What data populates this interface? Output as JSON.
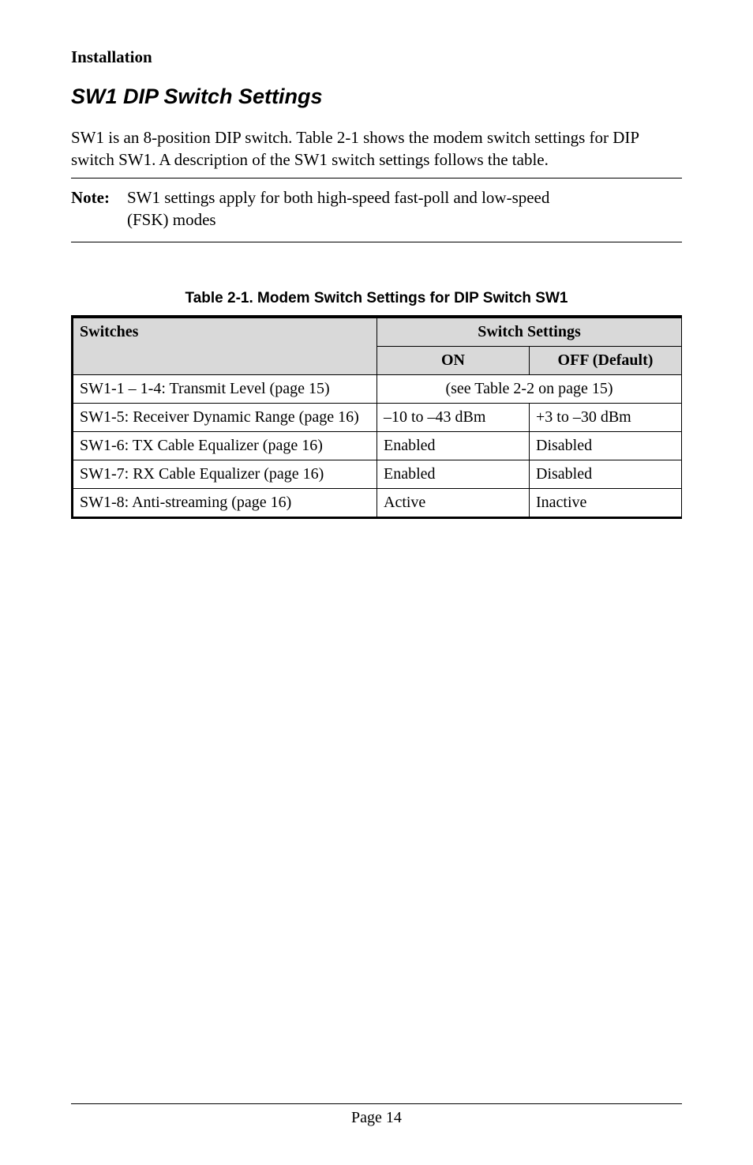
{
  "section_label": "Installation",
  "heading": "SW1 DIP Switch Settings",
  "intro": "SW1 is an 8-position DIP switch. Table 2-1 shows the modem switch settings for DIP switch SW1. A description of the SW1 switch settings follows the table.",
  "note": {
    "label": "Note:",
    "text": "SW1 settings apply for both high-speed fast-poll and low-speed (FSK) modes"
  },
  "table": {
    "caption": "Table 2-1. Modem Switch Settings for DIP Switch SW1",
    "head": {
      "switches": "Switches",
      "settings": "Switch Settings",
      "on": "ON",
      "off": "OFF (Default)"
    },
    "rows": [
      {
        "sw": "SW1-1 – 1-4: Transmit Level (page 15)",
        "merged": "(see Table 2-2 on page 15)"
      },
      {
        "sw": "SW1-5: Receiver Dynamic Range (page 16)",
        "on": "–10 to –43 dBm",
        "off": "+3 to –30 dBm"
      },
      {
        "sw": "SW1-6: TX Cable Equalizer (page 16)",
        "on": "Enabled",
        "off": "Disabled"
      },
      {
        "sw": "SW1-7: RX Cable Equalizer (page 16)",
        "on": "Enabled",
        "off": "Disabled"
      },
      {
        "sw": "SW1-8: Anti-streaming (page 16)",
        "on": "Active",
        "off": "Inactive"
      }
    ]
  },
  "footer": "Page 14"
}
